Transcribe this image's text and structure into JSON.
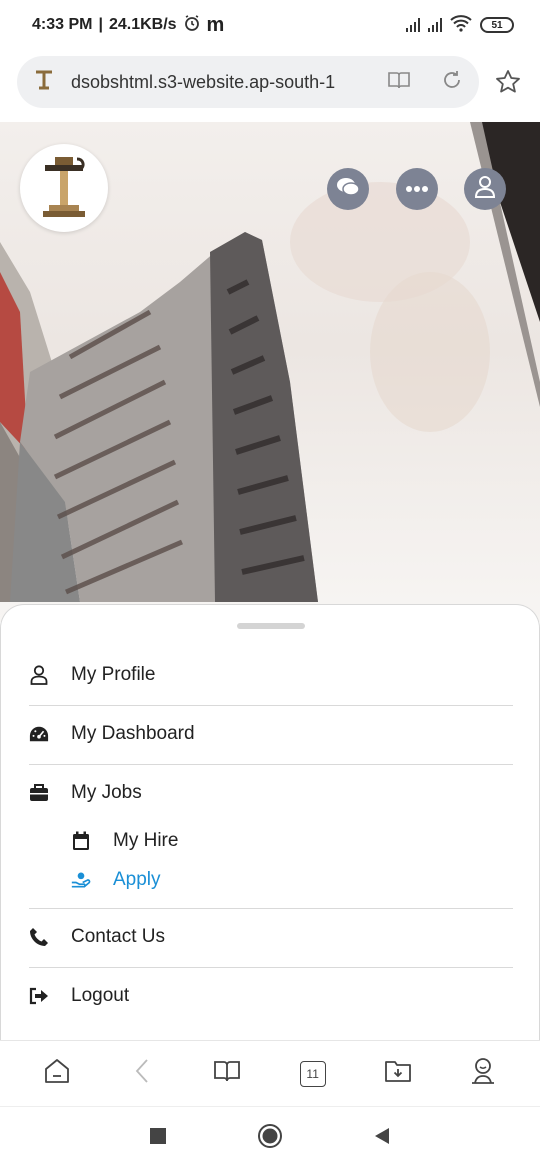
{
  "status": {
    "time": "4:33 PM",
    "speed": "24.1KB/s",
    "carrier_glyph": "m",
    "battery": "51"
  },
  "browser": {
    "url": "dsobshtml.s3-website.ap-south-1",
    "tab_count": "11"
  },
  "menu": {
    "items": [
      {
        "label": "My Profile",
        "icon": "user-icon"
      },
      {
        "label": "My Dashboard",
        "icon": "dashboard-icon"
      },
      {
        "label": "My Jobs",
        "icon": "briefcase-icon"
      },
      {
        "label": "Contact Us",
        "icon": "phone-icon"
      },
      {
        "label": "Logout",
        "icon": "logout-icon"
      }
    ],
    "sub_items": [
      {
        "label": "My Hire",
        "icon": "calendar-icon"
      },
      {
        "label": "Apply",
        "icon": "hand-user-icon"
      }
    ]
  },
  "colors": {
    "accent": "#1a8fd6",
    "hero_button": "#7d8394",
    "text": "#222222"
  }
}
